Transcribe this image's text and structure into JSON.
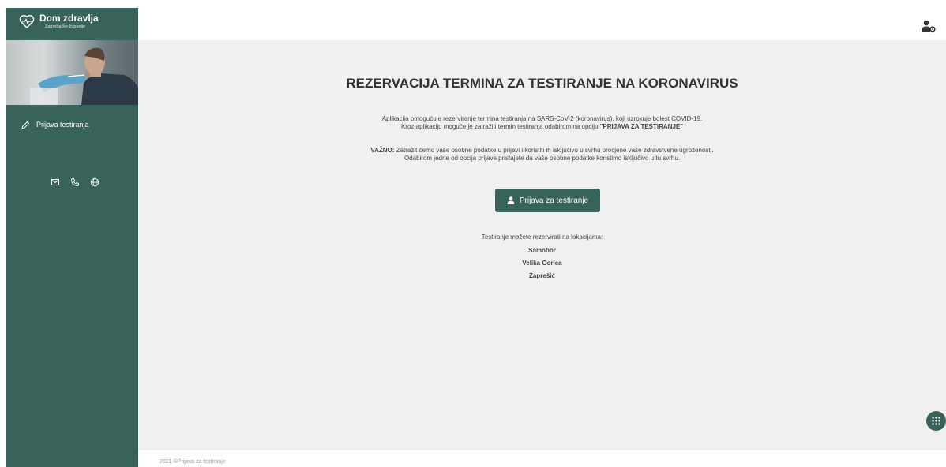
{
  "brand": {
    "title": "Dom zdravlja",
    "subtitle": "Zagrebačke županije"
  },
  "sidebar": {
    "items": [
      {
        "label": "Prijava testiranja",
        "icon": "pencil-icon"
      }
    ],
    "contact_icons": [
      "mail-icon",
      "phone-icon",
      "globe-icon"
    ]
  },
  "header": {
    "user_icon": "user-settings-icon"
  },
  "main": {
    "title": "REZERVACIJA TERMINA ZA TESTIRANJE NA KORONAVIRUS",
    "intro_line1": "Aplikacija omogućuje rezerviranje termina testiranja na SARS-CoV-2 (koronavirus), koji uzrokuje bolest COVID-19.",
    "intro_line2_prefix": "Kroz aplikaciju moguće je zatražiti termin testiranja odabirom na opciju ",
    "intro_line2_bold": "\"PRIJAVA ZA TESTIRANJE\"",
    "notice_label": "VAŽNO:",
    "notice_line1": " Zatražit ćemo vaše osobne podatke u prijavi i koristiti ih isključivo u svrhu procjene vaše zdravstvene ugroženosti.",
    "notice_line2": "Odabirom jedne od opcija prijave pristajete da vaše osobne podatke koristimo isključivo u tu svrhu.",
    "button_label": "Prijava za testiranje",
    "locations_intro": "Testiranje možete rezervirati na lokacijama:",
    "locations": [
      "Samobor",
      "Velika Gorica",
      "Zaprešić"
    ]
  },
  "footer": {
    "text": "2021 ©Prijava za testiranje"
  },
  "colors": {
    "primary": "#37635b",
    "background": "#f0f0f0"
  }
}
